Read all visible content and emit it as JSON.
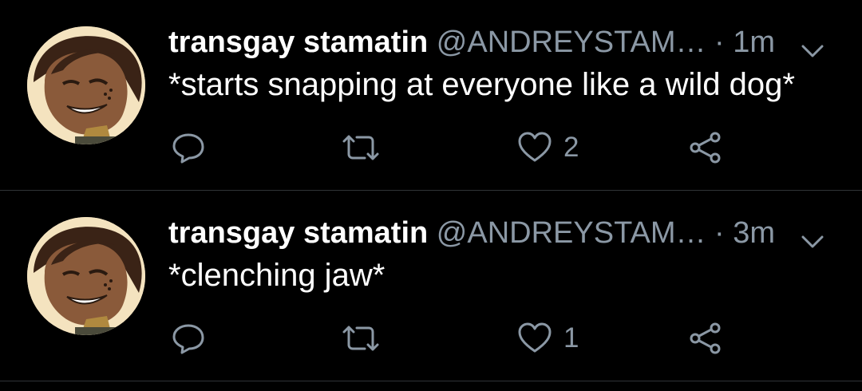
{
  "tweets": [
    {
      "name": "transgay stamatin",
      "handle": "@ANDREYSTAM…",
      "separator": "·",
      "time": "1m",
      "text": "*starts snapping at everyone like a wild dog*",
      "likes": "2"
    },
    {
      "name": "transgay stamatin",
      "handle": "@ANDREYSTAM…",
      "separator": "·",
      "time": "3m",
      "text": "*clenching jaw*",
      "likes": "1"
    }
  ],
  "icons": {
    "reply": "reply-icon",
    "retweet": "retweet-icon",
    "like": "heart-icon",
    "share": "share-icon",
    "more": "chevron-down-icon"
  },
  "colors": {
    "background": "#000000",
    "text": "#ffffff",
    "secondary": "#8b98a5",
    "icon": "#8b98a5",
    "divider": "#2f3336"
  }
}
